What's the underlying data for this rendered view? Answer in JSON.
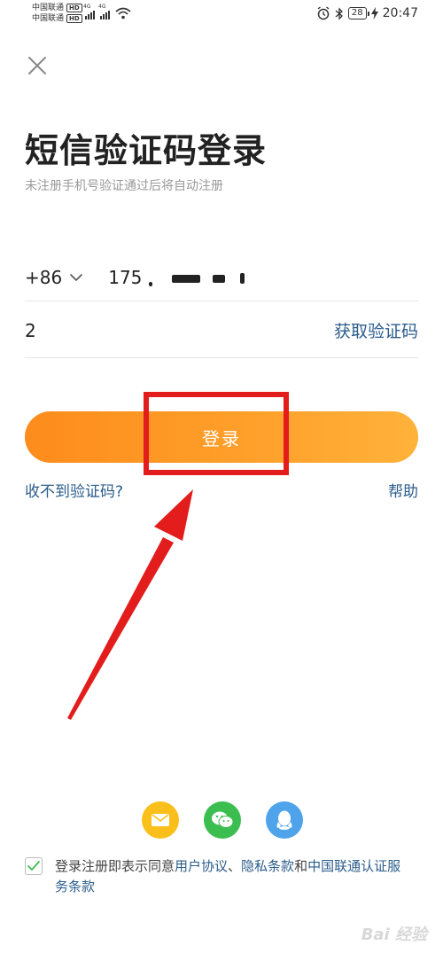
{
  "status_bar": {
    "carrier_1": "中国联通",
    "carrier_2": "中国联通",
    "hd": "HD",
    "net_1": "4G",
    "net_2": "4G",
    "battery": "28",
    "time": "20:47"
  },
  "login": {
    "title": "短信验证码登录",
    "subtitle": "未注册手机号验证通过后将自动注册",
    "country_code": "+86",
    "phone_prefix": "175",
    "code_value": "2",
    "get_code_label": "获取验证码",
    "login_button": "登录",
    "no_code_link": "收不到验证码?",
    "help_link": "帮助"
  },
  "social": {
    "icons": [
      "mail-icon",
      "wechat-icon",
      "qq-icon"
    ]
  },
  "agreement": {
    "prefix": "登录注册即表示同意",
    "user_agreement": "用户协议",
    "sep": "、",
    "privacy": "隐私条款",
    "and": "和",
    "service_terms": "中国联通认证服务条款"
  },
  "colors": {
    "accent_orange": "#fd8c1c",
    "link_blue": "#2b5d8c",
    "annotation_red": "#e31c1c"
  },
  "watermark": "Bai 经验"
}
